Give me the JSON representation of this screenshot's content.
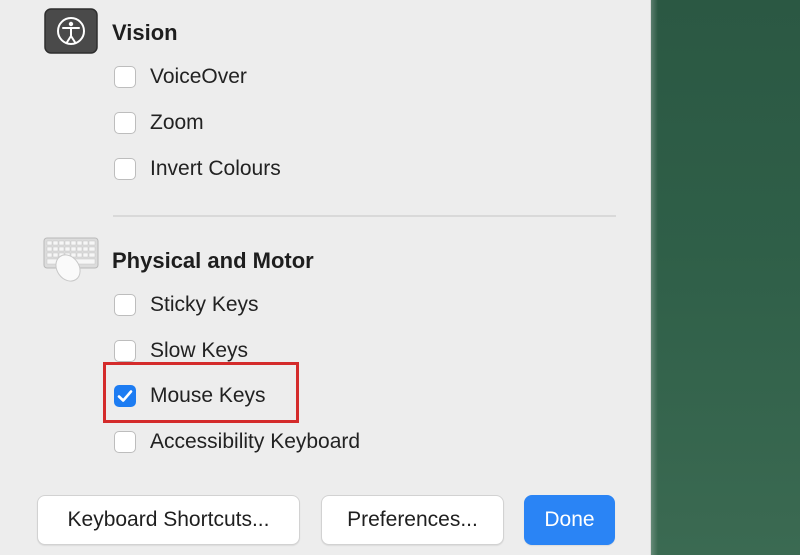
{
  "sections": {
    "vision": {
      "title": "Vision",
      "icon": "accessibility-icon",
      "options": [
        {
          "label": "VoiceOver",
          "checked": false
        },
        {
          "label": "Zoom",
          "checked": false
        },
        {
          "label": "Invert Colours",
          "checked": false
        }
      ]
    },
    "physical_motor": {
      "title": "Physical and Motor",
      "icon": "keyboard-mouse-icon",
      "options": [
        {
          "label": "Sticky Keys",
          "checked": false
        },
        {
          "label": "Slow Keys",
          "checked": false
        },
        {
          "label": "Mouse Keys",
          "checked": true
        },
        {
          "label": "Accessibility Keyboard",
          "checked": false
        }
      ]
    }
  },
  "buttons": {
    "keyboard_shortcuts": "Keyboard Shortcuts...",
    "preferences": "Preferences...",
    "done": "Done"
  },
  "colors": {
    "accent": "#2a84f5",
    "checkbox_checked": "#1d7cf2",
    "highlight_border": "#d42b2b",
    "desktop": "#2f5f48"
  }
}
